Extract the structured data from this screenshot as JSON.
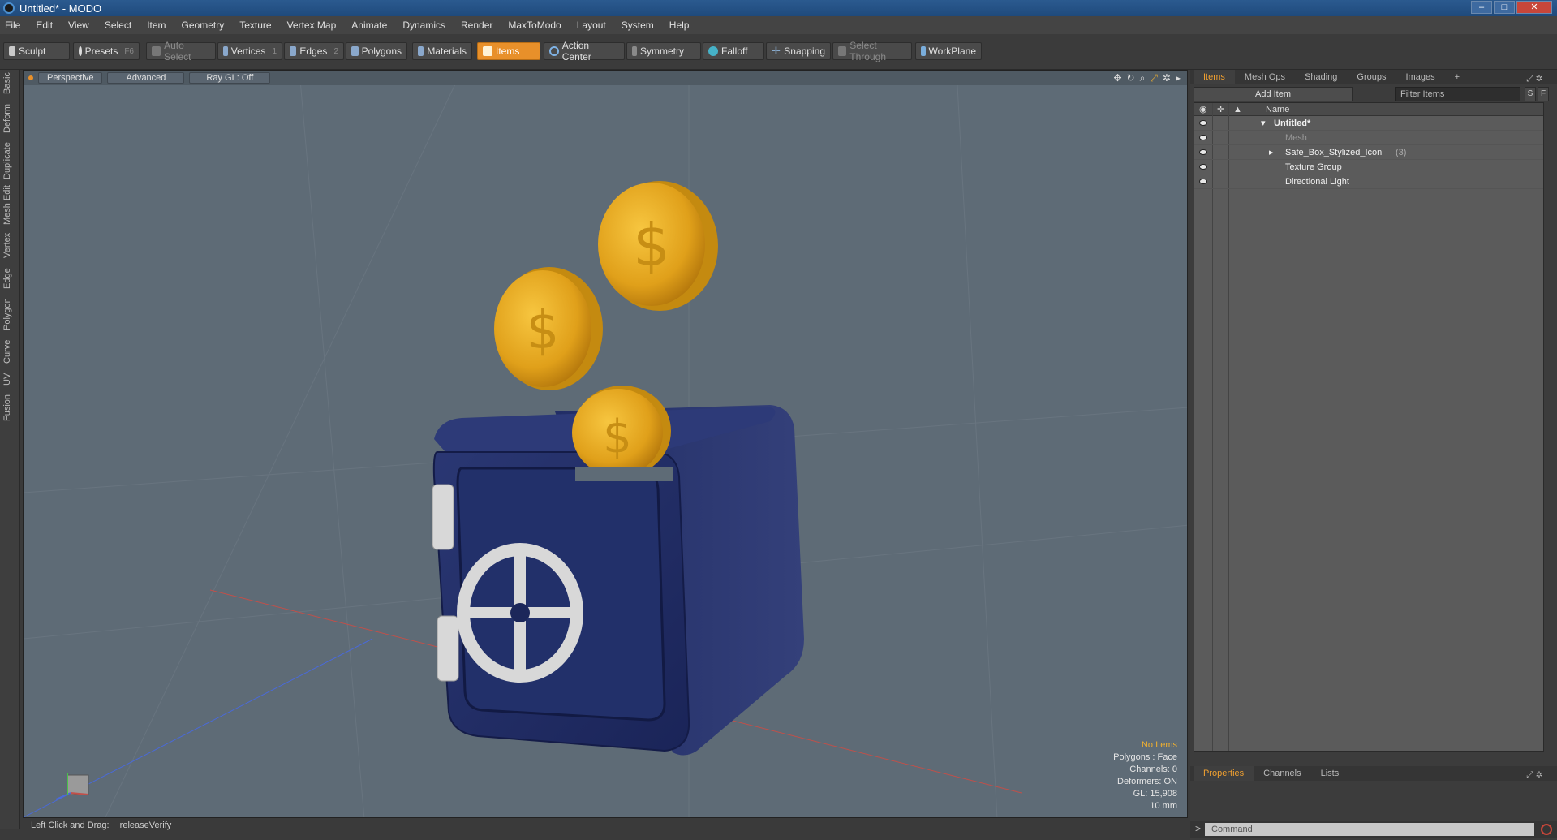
{
  "window": {
    "title": "Untitled* - MODO",
    "buttons": [
      "–",
      "□",
      "✕"
    ]
  },
  "menu": [
    "File",
    "Edit",
    "View",
    "Select",
    "Item",
    "Geometry",
    "Texture",
    "Vertex Map",
    "Animate",
    "Dynamics",
    "Render",
    "MaxToModo",
    "Layout",
    "System",
    "Help"
  ],
  "toolbar": {
    "sculpt": "Sculpt",
    "presets": "Presets",
    "presets_key": "F6",
    "auto_select": "Auto Select",
    "vertices": "Vertices",
    "vertices_key": "1",
    "edges": "Edges",
    "edges_key": "2",
    "polygons": "Polygons",
    "materials": "Materials",
    "items": "Items",
    "action_center": "Action Center",
    "symmetry": "Symmetry",
    "falloff": "Falloff",
    "snapping": "Snapping",
    "select_through": "Select Through",
    "workplane": "WorkPlane"
  },
  "left_tabs": [
    "Basic",
    "Deform",
    "Duplicate",
    "Mesh Edit",
    "Vertex",
    "Edge",
    "Polygon",
    "Curve",
    "UV",
    "Fusion"
  ],
  "viewport": {
    "mode": "Perspective",
    "shading": "Advanced",
    "raygl": "Ray GL: Off",
    "info": {
      "no_items": "No Items",
      "polygons": "Polygons : Face",
      "channels": "Channels: 0",
      "deformers": "Deformers: ON",
      "gl": "GL: 15,908",
      "scale": "10 mm"
    }
  },
  "status": {
    "hint_key": "Left Click and Drag:",
    "hint_action": "releaseVerify"
  },
  "right_panel": {
    "tabs": [
      "Items",
      "Mesh Ops",
      "Shading",
      "Groups",
      "Images",
      "+"
    ],
    "add_item": "Add Item",
    "filter_placeholder": "Filter Items",
    "s_btn": "S",
    "f_btn": "F",
    "col_name": "Name",
    "tree": [
      {
        "label": "Untitled*",
        "depth": 0
      },
      {
        "label": "Mesh",
        "depth": 1
      },
      {
        "label": "Safe_Box_Stylized_Icon",
        "count": "(3)",
        "depth": 1
      },
      {
        "label": "Texture Group",
        "depth": 1
      },
      {
        "label": "Directional Light",
        "depth": 1
      }
    ],
    "bottom_tabs": [
      "Properties",
      "Channels",
      "Lists",
      "+"
    ],
    "command_prompt": ">",
    "command_placeholder": "Command"
  },
  "colors": {
    "accent": "#e8902a",
    "viewport_bg": "#5e6b76",
    "safe_blue": "#1f2c66",
    "coin_gold": "#e3a51c"
  }
}
